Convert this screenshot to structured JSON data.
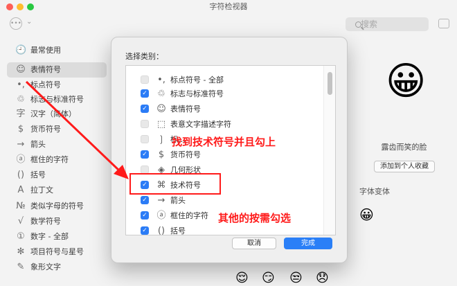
{
  "window": {
    "title": "字符检视器"
  },
  "colors": {
    "accent": "#2b7cf6",
    "annotation": "#ff1a1a",
    "traffic_close": "#fe5f57",
    "traffic_min": "#febc2e",
    "traffic_max": "#28c840"
  },
  "toolbar": {
    "more_icon": "ellipsis-icon",
    "search_placeholder": "搜索"
  },
  "sidebar": {
    "items": [
      {
        "icon": "🕘",
        "label": "最常使用"
      },
      {
        "icon": "☺",
        "label": "表情符号"
      },
      {
        "icon": "•,",
        "label": "标点符号"
      },
      {
        "icon": "♲",
        "label": "标志与标准符号"
      },
      {
        "icon": "字",
        "label": "汉字（简体）"
      },
      {
        "icon": "$",
        "label": "货币符号"
      },
      {
        "icon": "→",
        "label": "箭头"
      },
      {
        "icon": "ⓐ",
        "label": "框住的字符"
      },
      {
        "icon": "()",
        "label": "括号"
      },
      {
        "icon": "A",
        "label": "拉丁文"
      },
      {
        "icon": "№",
        "label": "类似字母的符号"
      },
      {
        "icon": "√",
        "label": "数学符号"
      },
      {
        "icon": "①",
        "label": "数字 - 全部"
      },
      {
        "icon": "✻",
        "label": "项目符号与星号"
      },
      {
        "icon": "✎",
        "label": "象形文字"
      }
    ]
  },
  "right_panel": {
    "preview": "😀",
    "name": "露齿而笑的脸",
    "add_favorite": "添加到个人收藏",
    "font_variants_label": "字体变体",
    "variant": "😀"
  },
  "bottom_emojis": [
    "😌",
    "😏",
    "😒",
    "😞"
  ],
  "dialog": {
    "title": "选择类别：",
    "rows": [
      {
        "icon": "•,",
        "label": "标点符号 - 全部",
        "checked": false
      },
      {
        "icon": "♲",
        "label": "标志与标准符号",
        "checked": true
      },
      {
        "icon": "☺",
        "label": "表情符号",
        "checked": true
      },
      {
        "icon": "⬚",
        "label": "表意文字描述字符",
        "checked": false
      },
      {
        "icon": "❳",
        "label": "标…",
        "checked": false
      },
      {
        "icon": "$",
        "label": "货币符号",
        "checked": true
      },
      {
        "icon": "◈",
        "label": "几何形状",
        "checked": false
      },
      {
        "icon": "⌘",
        "label": "技术符号",
        "checked": true
      },
      {
        "icon": "→",
        "label": "箭头",
        "checked": true
      },
      {
        "icon": "ⓐ",
        "label": "框住的字符",
        "checked": true
      },
      {
        "icon": "()",
        "label": "括号",
        "checked": true
      }
    ],
    "cancel": "取消",
    "done": "完成"
  },
  "annotations": {
    "find": "找到技术符号并且勾上",
    "others": "其他的按需勾选"
  }
}
